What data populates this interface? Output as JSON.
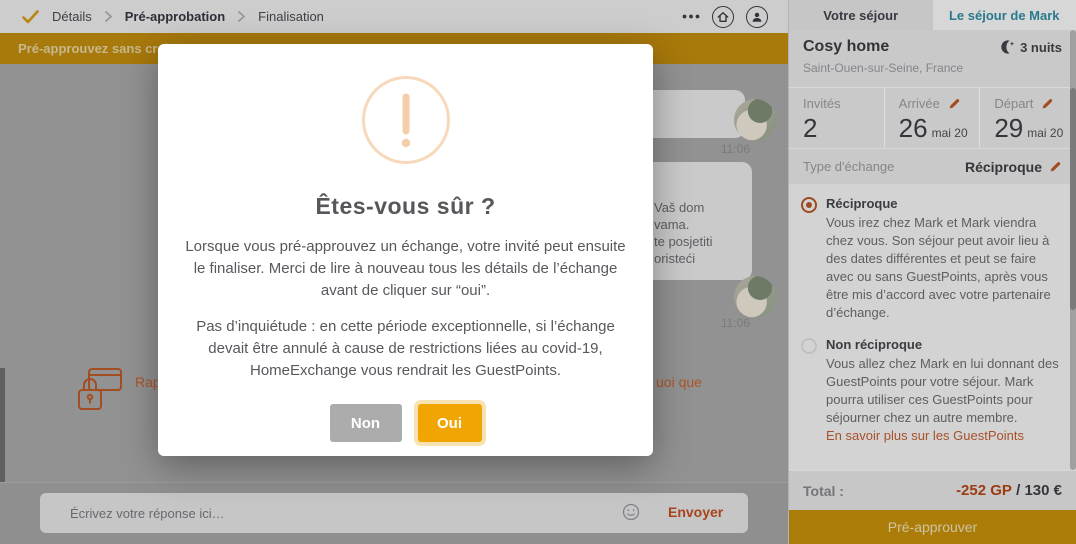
{
  "colors": {
    "brand_gold": "#f1a503",
    "banner_gold_dimmed": "#a8790b",
    "accent_orange_link": "#a8512a",
    "active_tab_teal": "#2a7a8e",
    "guestpoints_negative": "#9c3c12"
  },
  "breadcrumb": {
    "steps": [
      "Détails",
      "Pré-approbation",
      "Finalisation"
    ],
    "active_step": "Pré-approbation"
  },
  "banner": {
    "visible_text": "Pré-approuvez sans crain"
  },
  "chat": {
    "messages": [
      {
        "time": "11:06"
      },
      {
        "time": "11:06",
        "visible_lines": [
          "Vaš dom",
          "vama.",
          "te posjetiti",
          "oristeći"
        ]
      }
    ],
    "payment_note": {
      "left_fragment": "Rap",
      "right_fragment": "uoi que"
    }
  },
  "composer": {
    "placeholder": "Écrivez votre réponse ici…",
    "send_label": "Envoyer"
  },
  "modal": {
    "title": "Êtes-vous sûr ?",
    "paragraph_1": "Lorsque vous pré-approuvez un échange, votre invité peut ensuite le finaliser. Merci de lire à nouveau tous les détails de l’échange avant de cliquer sur “oui”.",
    "paragraph_2": "Pas d’inquiétude : en cette période exceptionnelle, si l’échange devait être annulé à cause de restrictions liées au covid-19, HomeExchange vous rendrait les GuestPoints.",
    "no_label": "Non",
    "yes_label": "Oui"
  },
  "sidebar": {
    "tabs": [
      {
        "label": "Votre séjour",
        "active": false
      },
      {
        "label": "Le séjour de Mark",
        "active": true
      }
    ],
    "home": {
      "title": "Cosy home",
      "nights": "3 nuits",
      "location": "Saint-Ouen-sur-Seine, France"
    },
    "details": {
      "guests_label": "Invités",
      "guests_value": "2",
      "arrival_label": "Arrivée",
      "arrival_day": "26",
      "arrival_month": "mai 20",
      "departure_label": "Départ",
      "departure_day": "29",
      "departure_month": "mai 20"
    },
    "exchange_type": {
      "label": "Type d'échange",
      "value": "Réciproque"
    },
    "options": [
      {
        "title": "Réciproque",
        "selected": true,
        "description": "Vous irez chez Mark et Mark viendra chez vous. Son séjour peut avoir lieu à des dates différentes et peut se faire avec ou sans GuestPoints, après vous être mis d’accord avec votre partenaire d’échange."
      },
      {
        "title": "Non réciproque",
        "selected": false,
        "description": "Vous allez chez Mark en lui donnant des GuestPoints pour votre séjour. Mark pourra utiliser ces GuestPoints pour séjourner chez un autre membre.",
        "link_label": "En savoir plus sur les GuestPoints"
      }
    ],
    "total": {
      "label": "Total :",
      "guestpoints": "-252 GP",
      "separator": " / ",
      "euros": "130 €"
    },
    "cta_label": "Pré-approuver"
  }
}
